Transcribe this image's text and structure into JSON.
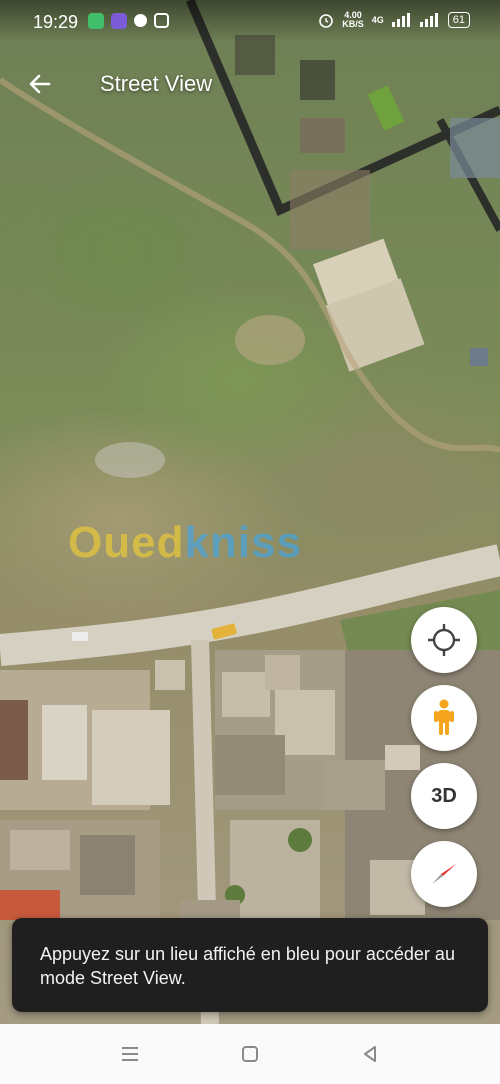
{
  "status_bar": {
    "time": "19:29",
    "net_speed_value": "4.00",
    "net_speed_unit": "KB/S",
    "signal_label": "4G",
    "battery": "61"
  },
  "header": {
    "title": "Street View"
  },
  "watermark": {
    "part1": "Oued",
    "part2": "kniss"
  },
  "map_controls": {
    "locate_icon": "crosshair-icon",
    "pegman_icon": "pegman-icon",
    "view_3d_label": "3D",
    "compass_icon": "compass-icon"
  },
  "toast": {
    "message": "Appuyez sur un lieu affiché en bleu pour accéder au mode Street View."
  },
  "colors": {
    "pegman": "#f4a41d",
    "compass_red": "#e53935",
    "toast_bg": "#1f1f1f"
  }
}
